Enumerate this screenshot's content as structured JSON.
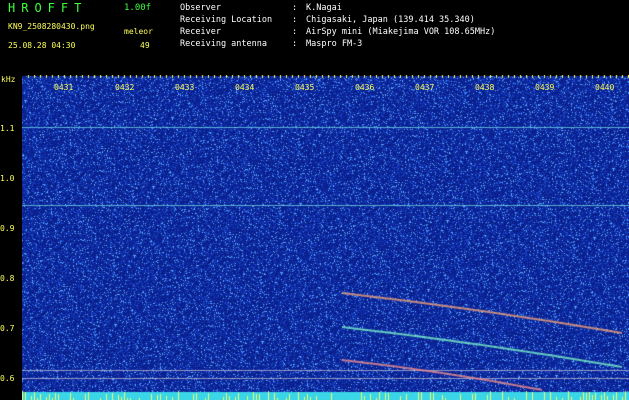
{
  "header": {
    "app_title": "HROFFT",
    "version": "1.00f",
    "filename": "KN9_2508280430.png",
    "datetime": "25.08.28 04:30",
    "mode": "meleor",
    "count": "49"
  },
  "station": {
    "observer_label": "Observer",
    "observer_value": "K.Nagai",
    "location_label": "Receiving Location",
    "location_value": "Chigasaki, Japan (139.414 35.340)",
    "receiver_label": "Receiver",
    "receiver_value": "AirSpy mini (Miakejima VOR 108.65MHz)",
    "antenna_label": "Receiving antenna",
    "antenna_value": "Maspro FM-3",
    "separator": ":"
  },
  "axes": {
    "y_unit": "kHz",
    "y_ticks": [
      "1.1",
      "1.0",
      "0.9",
      "0.8",
      "0.7",
      "0.6"
    ],
    "x_ticks": [
      "0431",
      "0432",
      "0433",
      "0434",
      "0435",
      "0436",
      "0437",
      "0438",
      "0439",
      "0440"
    ]
  },
  "colors": {
    "background_noise": "#0a1f8c",
    "label_yellow": "#ffff5a",
    "title_green": "#3cff3c"
  }
}
